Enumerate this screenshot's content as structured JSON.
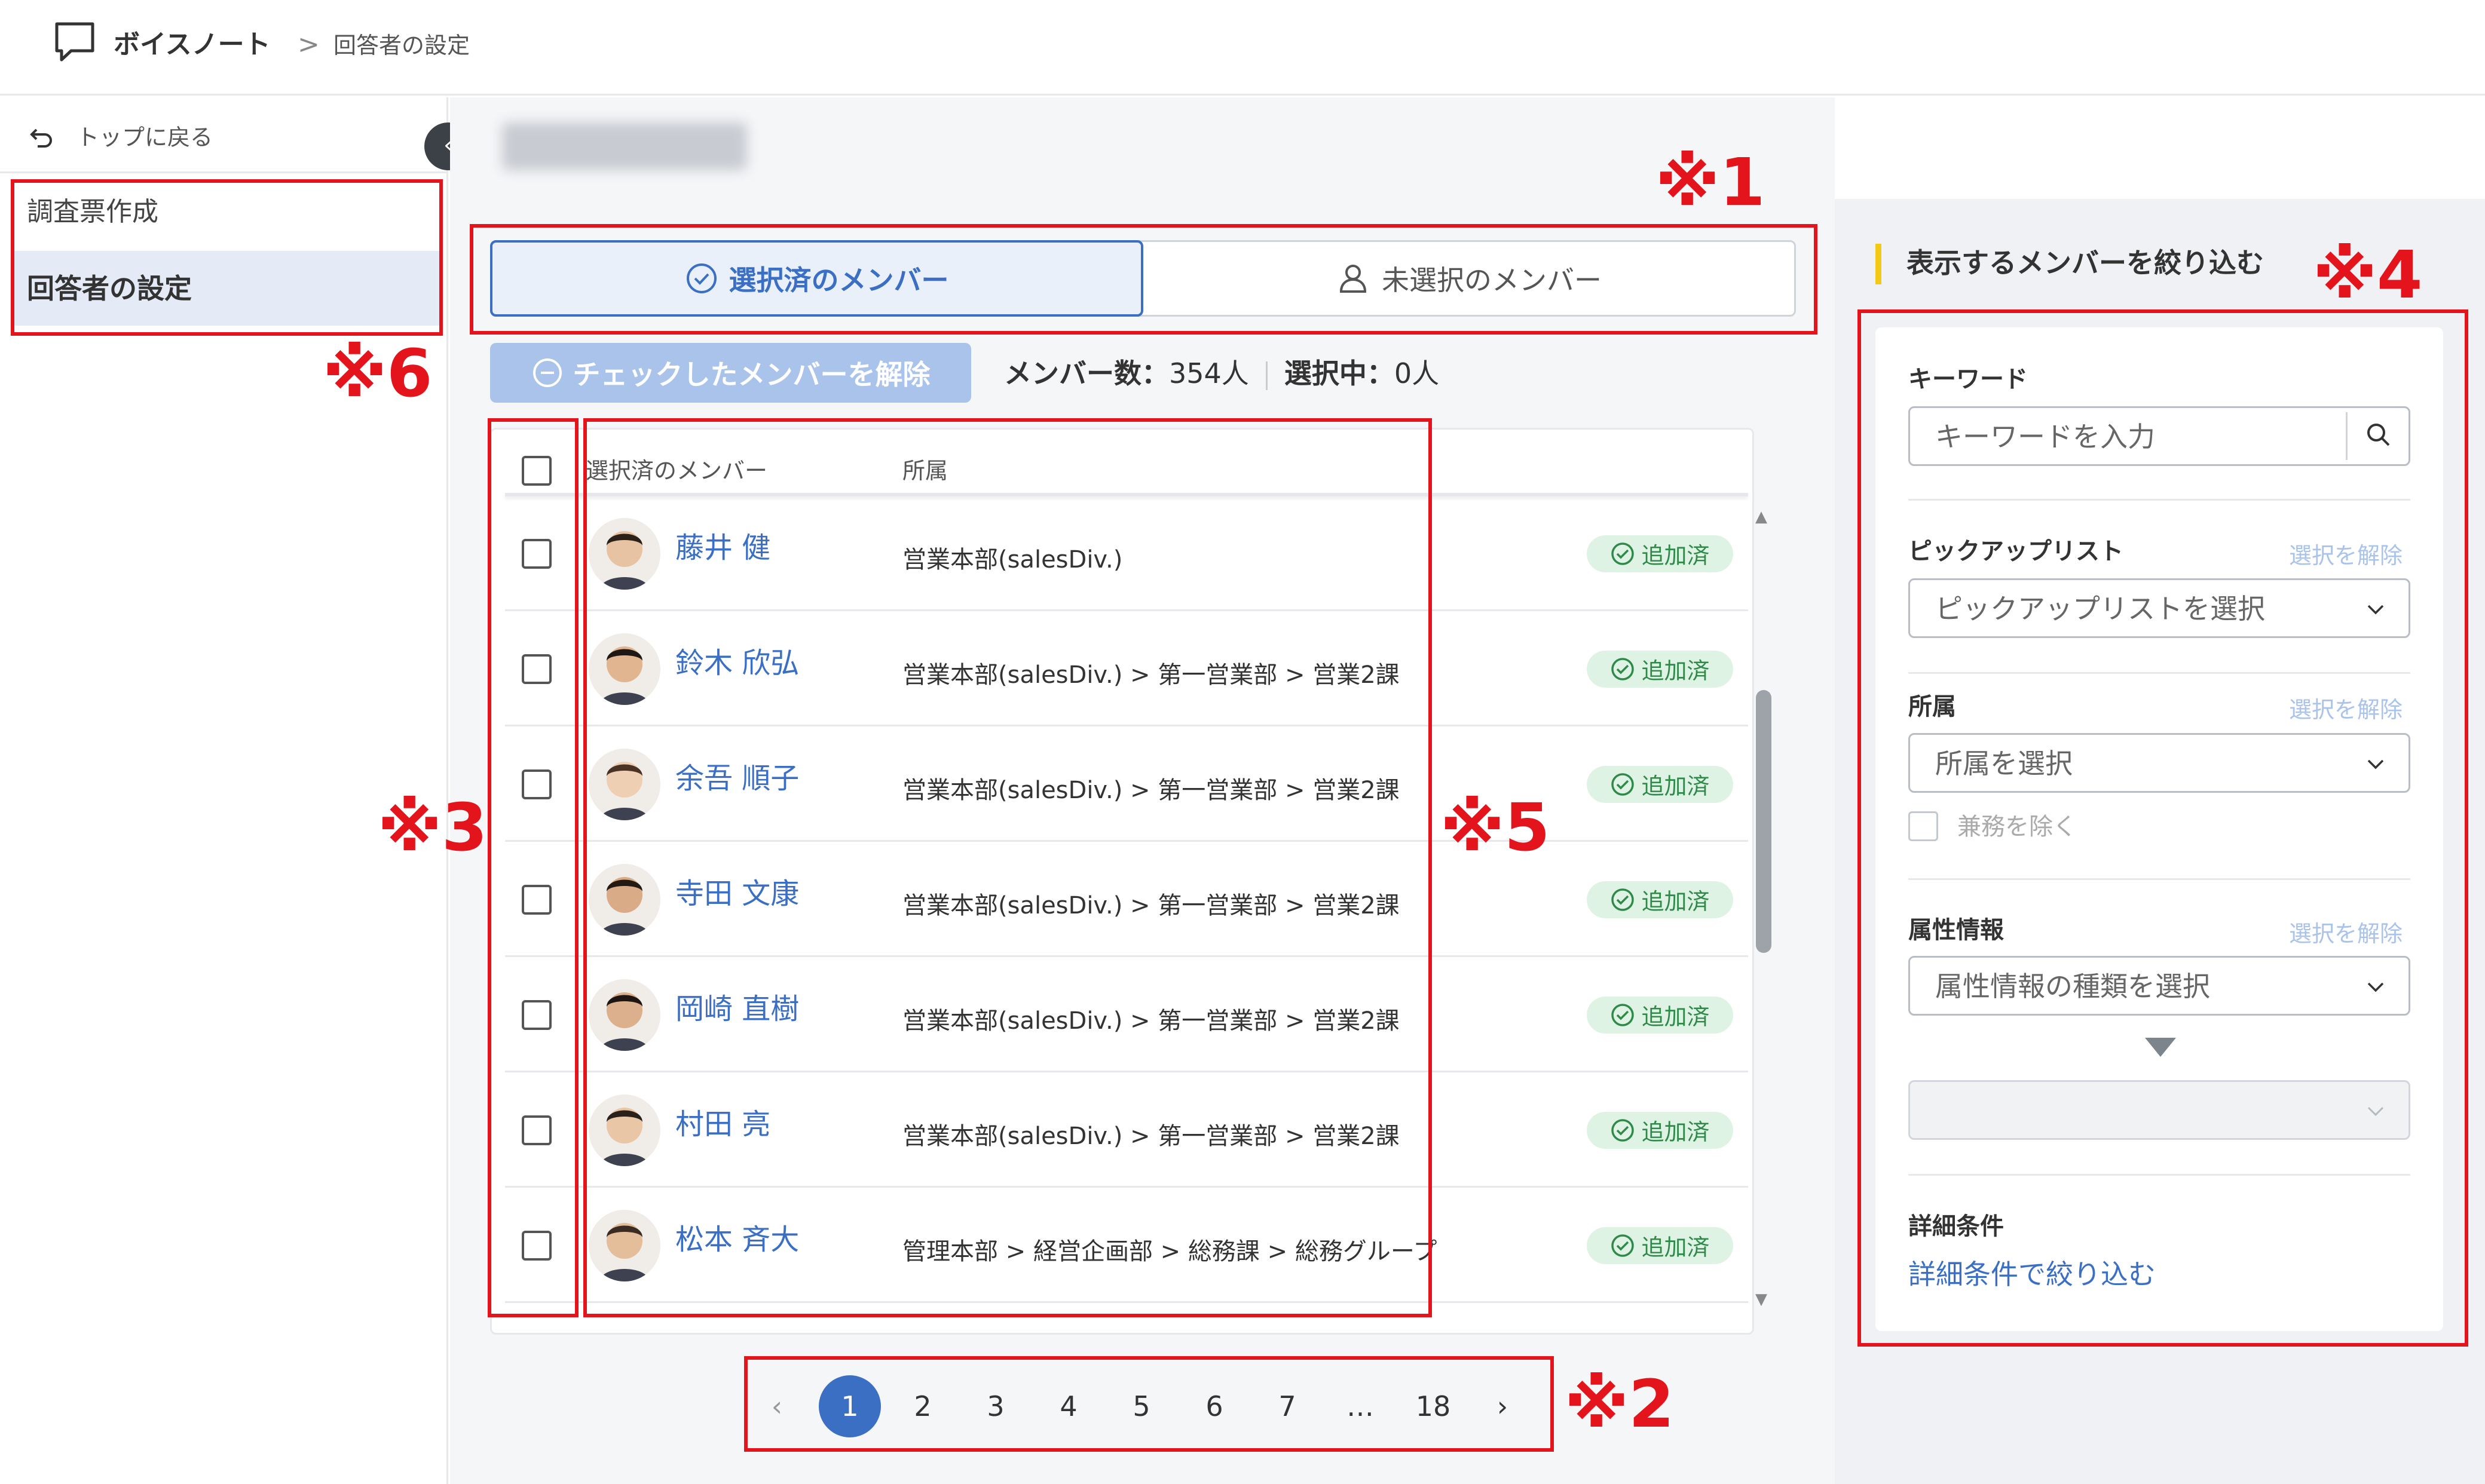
{
  "header": {
    "app_name": "ボイスノート",
    "breadcrumb_separator": ">",
    "breadcrumb_current": "回答者の設定"
  },
  "sidebar": {
    "back_label": "トップに戻る",
    "collapse_glyph": "‹",
    "items": [
      {
        "label": "調査票作成",
        "active": false
      },
      {
        "label": "回答者の設定",
        "active": true
      }
    ]
  },
  "main": {
    "tabs": [
      {
        "label": "選択済のメンバー",
        "icon": "check-circle-icon",
        "active": true
      },
      {
        "label": "未選択のメンバー",
        "icon": "user-icon",
        "active": false
      }
    ],
    "uncheck_button_label": "チェックしたメンバーを解除",
    "member_count_label": "メンバー数",
    "member_count_value": "354人",
    "selected_count_label": "選択中",
    "selected_count_value": "0人",
    "count_separator": "：",
    "table": {
      "headers": {
        "member": "選択済のメンバー",
        "dept": "所属"
      },
      "rows": [
        {
          "name": "藤井 健",
          "dept": "営業本部(salesDiv.)",
          "status": "追加済"
        },
        {
          "name": "鈴木 欣弘",
          "dept": "営業本部(salesDiv.) > 第一営業部 > 営業2課",
          "status": "追加済"
        },
        {
          "name": "余吾 順子",
          "dept": "営業本部(salesDiv.) > 第一営業部 > 営業2課",
          "status": "追加済"
        },
        {
          "name": "寺田 文康",
          "dept": "営業本部(salesDiv.) > 第一営業部 > 営業2課",
          "status": "追加済"
        },
        {
          "name": "岡崎 直樹",
          "dept": "営業本部(salesDiv.) > 第一営業部 > 営業2課",
          "status": "追加済"
        },
        {
          "name": "村田 亮",
          "dept": "営業本部(salesDiv.) > 第一営業部 > 営業2課",
          "status": "追加済"
        },
        {
          "name": "松本 斉大",
          "dept": "管理本部 > 経営企画部 > 総務課 > 総務グループ",
          "status": "追加済"
        }
      ]
    },
    "pagination": {
      "prev": "‹",
      "next": "›",
      "pages": [
        "1",
        "2",
        "3",
        "4",
        "5",
        "6",
        "7",
        "…",
        "18"
      ],
      "current": "1"
    }
  },
  "filter": {
    "title": "表示するメンバーを絞り込む",
    "keyword": {
      "label": "キーワード",
      "placeholder": "キーワードを入力"
    },
    "picklist": {
      "label": "ピックアップリスト",
      "clear": "選択を解除",
      "placeholder": "ピックアップリストを選択"
    },
    "department": {
      "label": "所属",
      "clear": "選択を解除",
      "placeholder": "所属を選択",
      "exclude_label": "兼務を除く"
    },
    "attribute": {
      "label": "属性情報",
      "clear": "選択を解除",
      "placeholder": "属性情報の種類を選択"
    },
    "detail": {
      "label": "詳細条件",
      "link": "詳細条件で絞り込む"
    }
  },
  "annotations": [
    "※1",
    "※2",
    "※3",
    "※4",
    "※5",
    "※6"
  ],
  "colors": {
    "accent": "#3b6fc4",
    "annotation": "#e3141b",
    "badge_bg": "#dff3e4",
    "badge_text": "#2f8a4a",
    "filter_accent": "#f2c914"
  }
}
